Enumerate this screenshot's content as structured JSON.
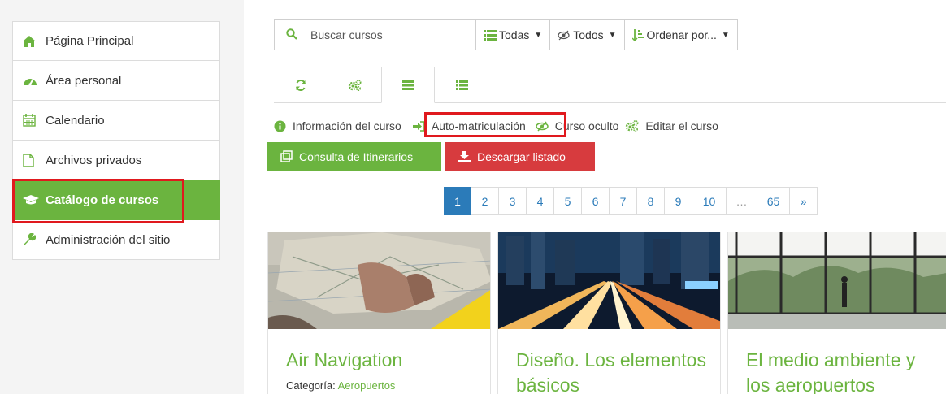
{
  "sidebar": {
    "items": [
      {
        "label": "Página Principal",
        "icon": "home-icon"
      },
      {
        "label": "Área personal",
        "icon": "dashboard-icon"
      },
      {
        "label": "Calendario",
        "icon": "calendar-icon"
      },
      {
        "label": "Archivos privados",
        "icon": "file-icon"
      },
      {
        "label": "Catálogo de cursos",
        "icon": "graduation-cap-icon",
        "active": true
      },
      {
        "label": "Administración del sitio",
        "icon": "wrench-icon"
      }
    ]
  },
  "toolbar": {
    "search_placeholder": "Buscar cursos",
    "filter_category": "Todas",
    "filter_visibility": "Todos",
    "sort_label": "Ordenar por..."
  },
  "legend": {
    "info": "Información del curso",
    "enrol": "Auto-matriculación",
    "hidden": "Curso oculto",
    "edit": "Editar el curso"
  },
  "buttons": {
    "itineraries": "Consulta de Itinerarios",
    "download": "Descargar listado"
  },
  "pagination": {
    "pages": [
      "1",
      "2",
      "3",
      "4",
      "5",
      "6",
      "7",
      "8",
      "9",
      "10",
      "…",
      "65",
      "»"
    ],
    "current": "1"
  },
  "courses": [
    {
      "title": "Air Navigation",
      "category_label": "Categoría:",
      "category": "Aeropuertos"
    },
    {
      "title": "Diseño. Los elementos básicos",
      "category_label": "",
      "category": ""
    },
    {
      "title": "El medio ambiente y los aeropuertos",
      "category_label": "",
      "category": ""
    }
  ],
  "colors": {
    "brand_green": "#6bb43f",
    "danger_red": "#d73b3e",
    "link_blue": "#2b7bb9",
    "highlight_red": "#e0191e"
  }
}
